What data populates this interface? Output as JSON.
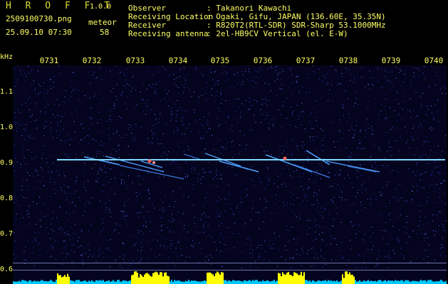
{
  "header": {
    "app_name": "H R O F F T",
    "version": "1.0.0",
    "filename": "2509100730.png",
    "datetime": "25.09.10 07:30",
    "count_label": "meteor",
    "count": "58",
    "info": [
      {
        "key": "Observer",
        "value": ": Takanori Kawachi"
      },
      {
        "key": "Receiving Location",
        "value": ": Ogaki, Gifu, JAPAN (136.60E, 35.35N)"
      },
      {
        "key": "Receiver",
        "value": ": R820T2(RTL-SDR) SDR-Sharp 53.1000MHz"
      },
      {
        "key": "Receiving antenna",
        "value": ": 2el-HB9CV Vertical (el. E-W)"
      }
    ]
  },
  "spectrogram": {
    "y_unit": "kHz",
    "y_ticks": [
      "1.1",
      "1.0",
      "0.9",
      "0.8",
      "0.7",
      "0.6"
    ],
    "x_ticks": [
      "0731",
      "0732",
      "0733",
      "0734",
      "0735",
      "0736",
      "0737",
      "0738",
      "0739",
      "0740"
    ],
    "colors": {
      "background": "#04041e",
      "carrier": "#7fd8ff",
      "echo": "#ff6060",
      "bars": "#ffff00",
      "base": "#00c8ff",
      "text": "#ffff66"
    }
  }
}
